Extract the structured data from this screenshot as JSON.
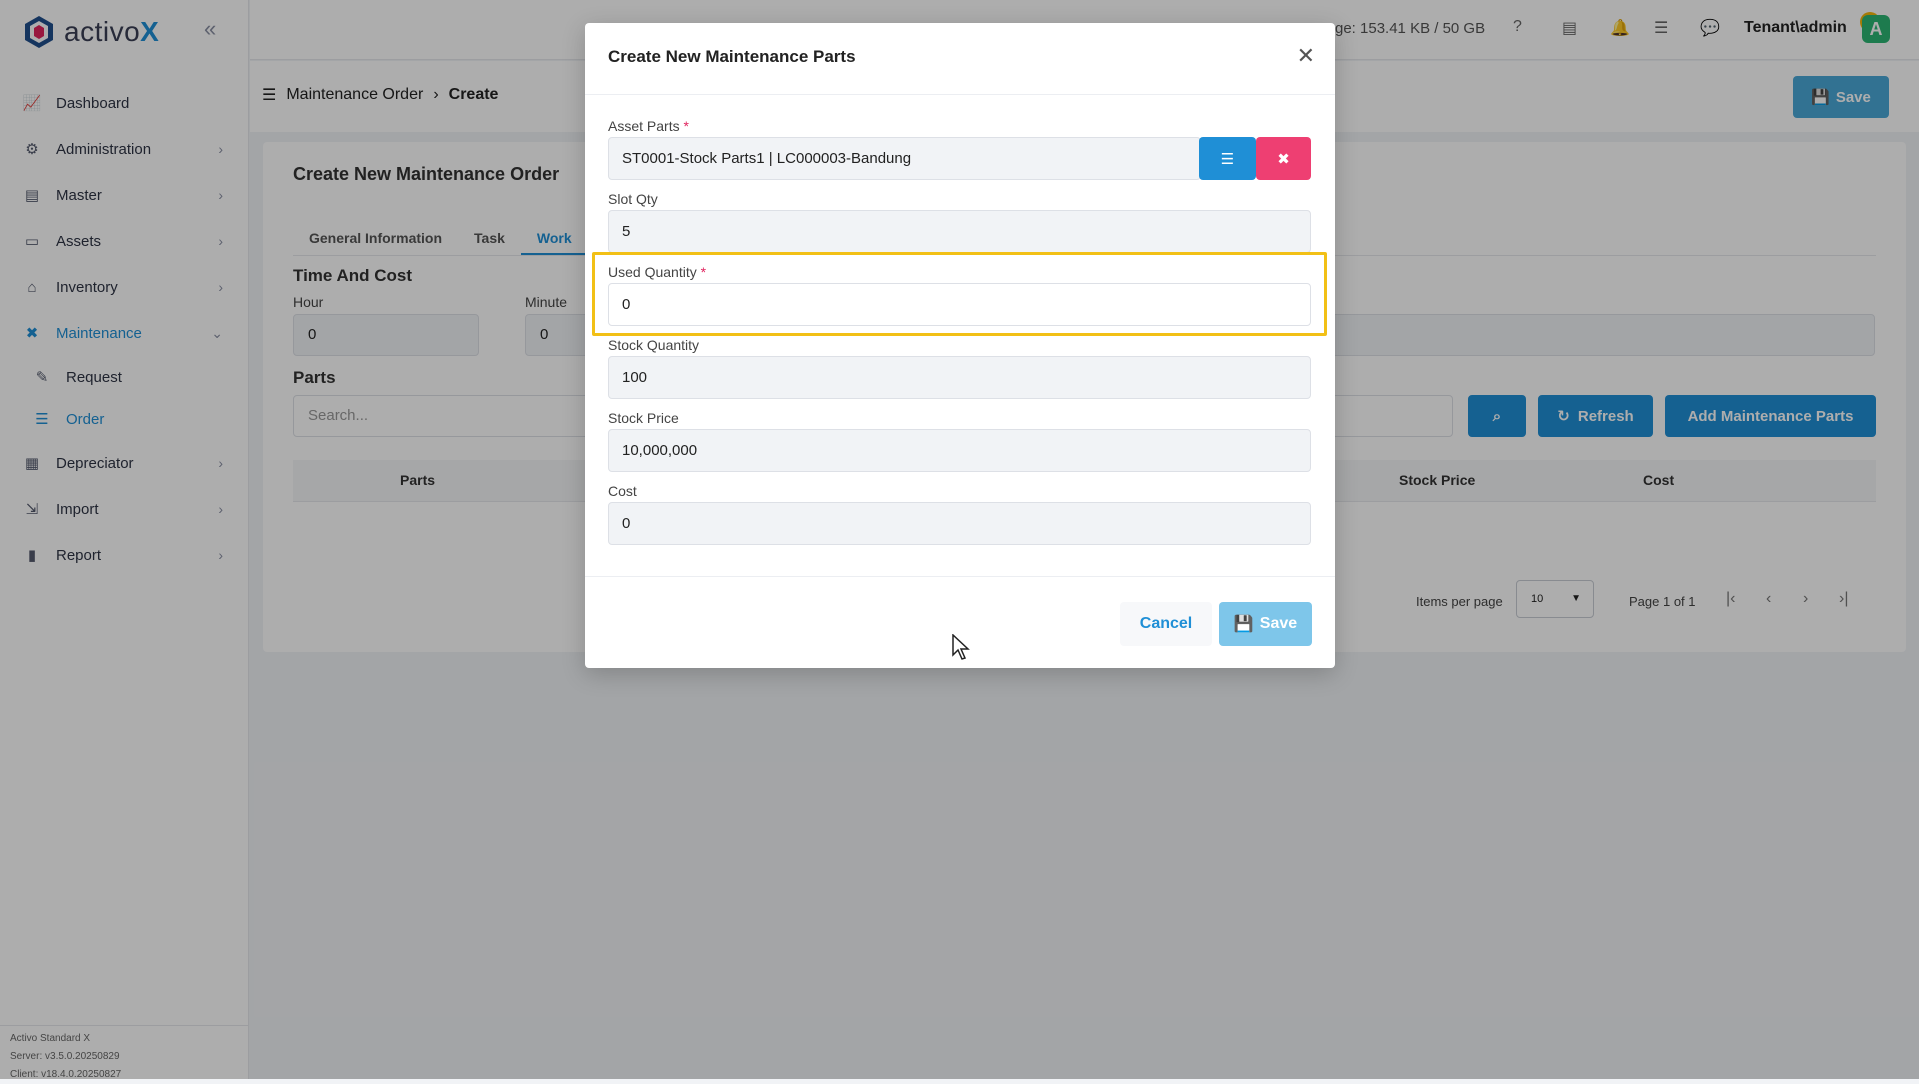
{
  "app": {
    "logo_prefix": "activo",
    "logo_suffix": "X",
    "storage_text": "ge: 153.41 KB / 50 GB",
    "notification_count": "3",
    "user": "Tenant\\admin",
    "avatar_letter": "A",
    "version_lines": [
      "Activo Standard X",
      "Server: v3.5.0.20250829",
      "Client: v18.4.0.20250827"
    ]
  },
  "sidebar": {
    "items": [
      {
        "label": "Dashboard",
        "icon": "chart-line-icon"
      },
      {
        "label": "Administration",
        "icon": "gears-icon"
      },
      {
        "label": "Master",
        "icon": "database-icon"
      },
      {
        "label": "Assets",
        "icon": "laptop-icon"
      },
      {
        "label": "Inventory",
        "icon": "warehouse-icon"
      },
      {
        "label": "Maintenance",
        "icon": "tools-icon"
      },
      {
        "label": "Request",
        "icon": "edit-icon"
      },
      {
        "label": "Order",
        "icon": "list-icon"
      },
      {
        "label": "Depreciator",
        "icon": "calculator-icon"
      },
      {
        "label": "Import",
        "icon": "file-import-icon"
      },
      {
        "label": "Report",
        "icon": "chart-bar-icon"
      }
    ]
  },
  "header": {
    "breadcrumb_parent": "Maintenance Order",
    "breadcrumb_current": "Create",
    "save_label": "Save"
  },
  "card": {
    "title": "Create New Maintenance Order",
    "tabs": [
      "General Information",
      "Task",
      "Work"
    ],
    "time_section": "Time And Cost",
    "hour_label": "Hour",
    "hour_value": "0",
    "minute_label": "Minute",
    "minute_value": "0",
    "parts_section": "Parts",
    "search_placeholder": "Search...",
    "refresh_label": "Refresh",
    "add_parts_label": "Add Maintenance Parts",
    "columns": [
      "Parts",
      "Stock Price",
      "Cost"
    ],
    "items_per_page_label": "Items per page",
    "items_per_page_value": "10",
    "page_info": "Page 1 of 1"
  },
  "modal": {
    "title": "Create New Maintenance Parts",
    "asset_parts_label": "Asset Parts",
    "asset_parts_value": "ST0001-Stock Parts1 | LC000003-Bandung",
    "slot_qty_label": "Slot Qty",
    "slot_qty_value": "5",
    "used_qty_label": "Used Quantity",
    "used_qty_value": "0",
    "stock_qty_label": "Stock Quantity",
    "stock_qty_value": "100",
    "stock_price_label": "Stock Price",
    "stock_price_value": "10,000,000",
    "cost_label": "Cost",
    "cost_value": "0",
    "cancel_label": "Cancel",
    "save_label": "Save",
    "required_mark": "*"
  },
  "colors": {
    "accent": "#1f8fd6",
    "danger": "#ee3f72",
    "highlight": "#f2c016"
  }
}
